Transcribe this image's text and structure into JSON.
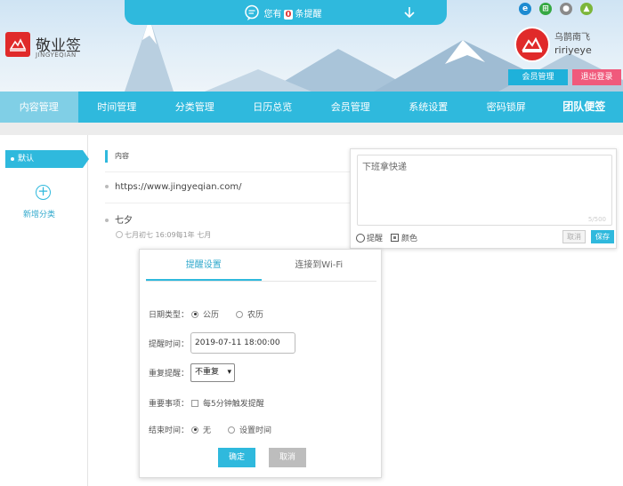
{
  "notification": {
    "prefix": "您有",
    "count": "0",
    "suffix": "条提醒"
  },
  "brand": {
    "title": "敬业签",
    "subtitle": "JINGYEQIAN",
    "color": "#e02a2a"
  },
  "os_icons": [
    "ie-icon",
    "windows-icon",
    "apple-icon",
    "android-icon"
  ],
  "user": {
    "name_cn": "乌鹊南飞",
    "name_en": "ririyeye",
    "member_button": "会员管理",
    "logout_button": "退出登录"
  },
  "nav": {
    "items": [
      "内容管理",
      "时间管理",
      "分类管理",
      "日历总览",
      "会员管理",
      "系统设置",
      "密码锁屏",
      "团队便签"
    ],
    "active_index": 0
  },
  "sidebar": {
    "default_category": "默认",
    "add_category": "新增分类"
  },
  "content": {
    "header": "内容",
    "items": [
      {
        "text": "https://www.jingyeqian.com/"
      },
      {
        "text": "七夕",
        "meta": "七月初七 16:09每1年 七月"
      }
    ]
  },
  "editor": {
    "text": "下班拿快递",
    "char_count": "5/500",
    "remind_label": "提醒",
    "color_label": "颜色",
    "cancel": "取消",
    "save": "保存"
  },
  "remind_popup": {
    "tabs": [
      "提醒设置",
      "连接到Wi-Fi"
    ],
    "active_tab": 0,
    "date_type_label": "日期类型：",
    "date_type_options": [
      "公历",
      "农历"
    ],
    "date_type_selected": "公历",
    "remind_time_label": "提醒时间：",
    "remind_time_value": "2019-07-11 18:00:00",
    "repeat_label": "重复提醒：",
    "repeat_value": "不重复",
    "important_label": "重要事项：",
    "important_option": "每5分钟触发提醒",
    "end_time_label": "结束时间：",
    "end_time_options": [
      "无",
      "设置时间"
    ],
    "end_time_selected": "无",
    "confirm": "确定",
    "cancel": "取消"
  },
  "colors": {
    "accent": "#2fb9dd",
    "nav_active": "#80cfe6",
    "logout": "#f05a7c"
  }
}
